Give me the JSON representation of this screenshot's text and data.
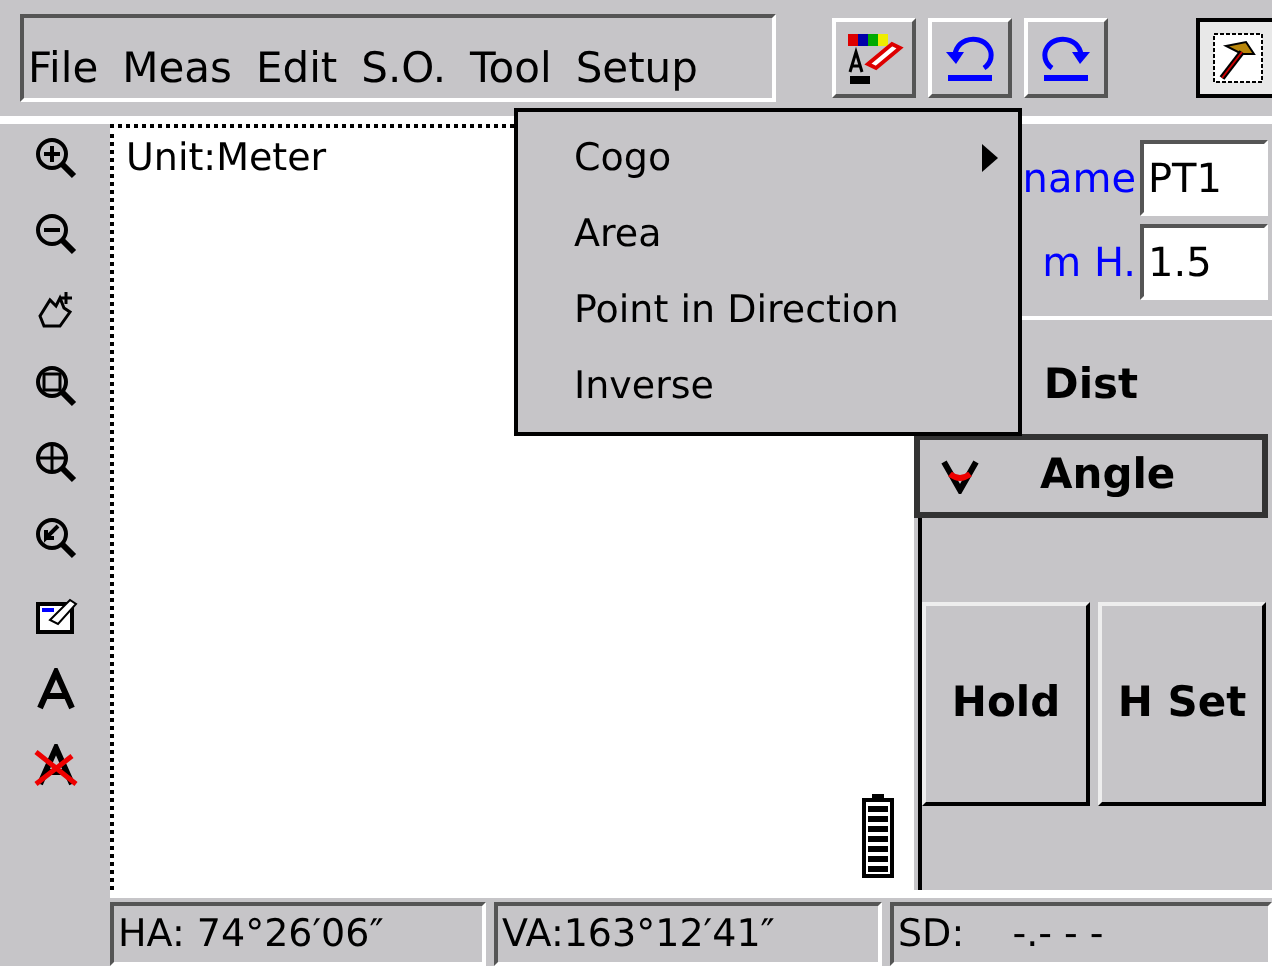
{
  "menubar": [
    "File",
    "Meas",
    "Edit",
    "S.O.",
    "Tool",
    "Setup"
  ],
  "menu": [
    {
      "label": "Cogo",
      "submenu": true
    },
    {
      "label": "Area",
      "submenu": false
    },
    {
      "label": "Point in Direction",
      "submenu": false
    },
    {
      "label": "Inverse",
      "submenu": false
    }
  ],
  "canvas": {
    "unit": "Unit:Meter"
  },
  "fields": [
    {
      "label": "name",
      "value": "PT1"
    },
    {
      "label": "m H.",
      "value": "1.5"
    }
  ],
  "modes": [
    {
      "label": "Dist",
      "selected": false
    },
    {
      "label": "Angle",
      "selected": true
    }
  ],
  "actions": [
    "Hold",
    "H Set"
  ],
  "status": [
    "HA: 74°26′06″",
    "VA:163°12′41″",
    "SD:    -.- - -"
  ]
}
